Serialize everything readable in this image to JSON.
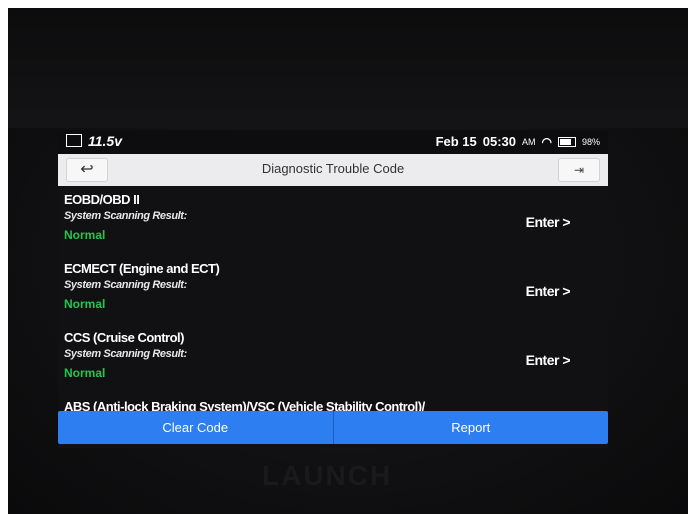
{
  "status_bar": {
    "voltage": "11.5v",
    "date": "Feb 15",
    "time": "05:30",
    "ampm": "AM",
    "battery": "98%"
  },
  "header": {
    "title": "Diagnostic Trouble Code"
  },
  "systems": [
    {
      "name": "EOBD/OBD II",
      "label": "System Scanning Result:",
      "result": "Normal",
      "action": "Enter >"
    },
    {
      "name": "ECMECT (Engine and ECT)",
      "label": "System Scanning Result:",
      "result": "Normal",
      "action": "Enter >"
    },
    {
      "name": "CCS (Cruise Control)",
      "label": "System Scanning Result:",
      "result": "Normal",
      "action": "Enter >"
    },
    {
      "name": "ABS (Anti-lock Braking System)/VSC (Vehicle Stability Control)/"
    }
  ],
  "actions": {
    "clear_code": "Clear Code",
    "report": "Report"
  },
  "brand": "LAUNCH",
  "colors": {
    "accent": "#2d7ef0",
    "normal_status": "#22c64d"
  }
}
